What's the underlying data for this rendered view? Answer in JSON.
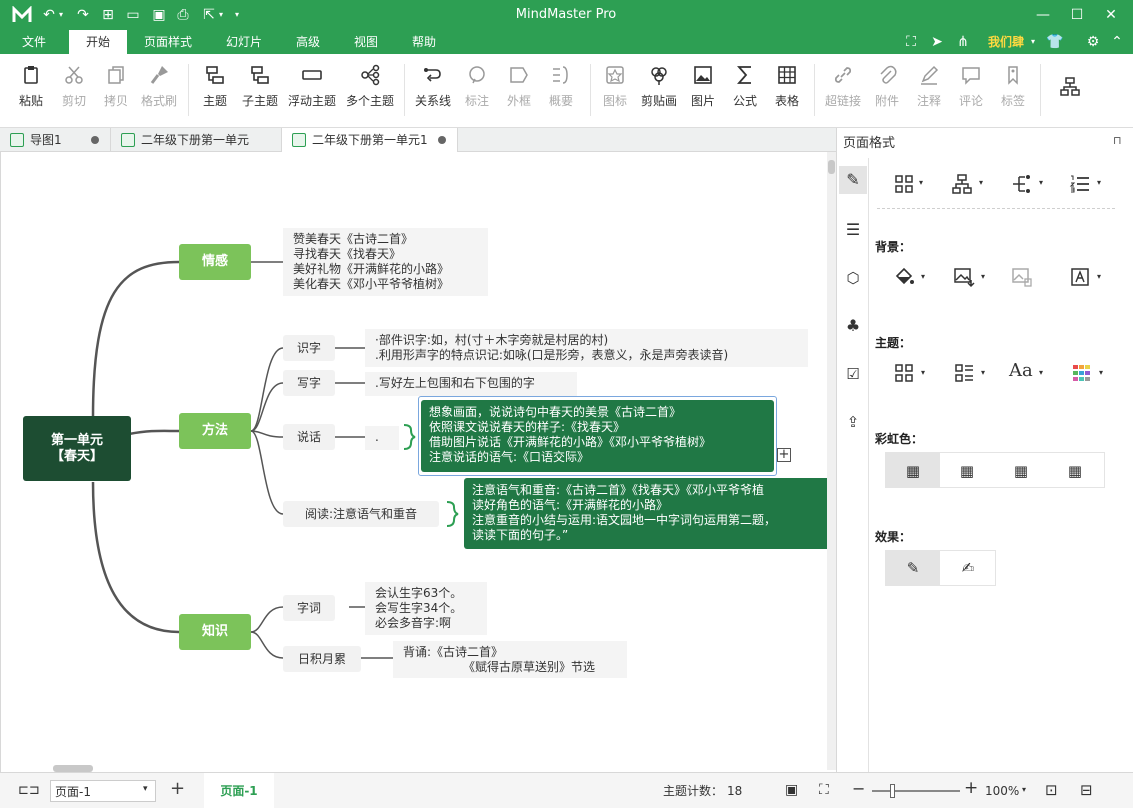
{
  "app": {
    "title": "MindMaster Pro",
    "user": "我们肆"
  },
  "menu": {
    "items": [
      "文件",
      "开始",
      "页面样式",
      "幻灯片",
      "高级",
      "视图",
      "帮助"
    ],
    "active": "开始"
  },
  "ribbon": {
    "buttons": [
      "粘贴",
      "剪切",
      "拷贝",
      "格式刷",
      "主题",
      "子主题",
      "浮动主题",
      "多个主题",
      "关系线",
      "标注",
      "外框",
      "概要",
      "图标",
      "剪贴画",
      "图片",
      "公式",
      "表格",
      "超链接",
      "附件",
      "注释",
      "评论",
      "标签"
    ]
  },
  "tabs": [
    {
      "label": "导图1"
    },
    {
      "label": "二年级下册第一单元"
    },
    {
      "label": "二年级下册第一单元1"
    }
  ],
  "mindmap": {
    "root": "第一单元\n【春天】",
    "branches": {
      "emotion": "情感",
      "method": "方法",
      "knowledge": "知识"
    },
    "emotion_notes": [
      "赞美春天《古诗二首》",
      "寻找春天《找春天》",
      "美好礼物《开满鲜花的小路》",
      "美化春天《邓小平爷爷植树》"
    ],
    "method_subs": {
      "shizi": "识字",
      "xiezi": "写字",
      "shuohua": "说话",
      "yuedu": "阅读:注意语气和重音"
    },
    "shizi_notes": [
      "·部件识字:如，村(寸＋木字旁就是村居的村)",
      ".利用形声字的特点识记:如咏(口是形旁，表意义，永是声旁表读音)"
    ],
    "xiezi_note": ".写好左上包围和右下包围的字",
    "shuohua_note": ".",
    "shuohua_box": [
      "想象画面，说说诗句中春天的美景《古诗二首》",
      "依照课文说说春天的样子:《找春天》",
      "借助图片说话《开满鲜花的小路》《邓小平爷爷植树》",
      "注意说话的语气:《口语交际》"
    ],
    "yuedu_box": [
      "注意语气和重音:《古诗二首》《找春天》《邓小平爷爷植",
      "读好角色的语气:《开满鲜花的小路》",
      "注意重音的小结与运用:语文园地一中字词句运用第二题，",
      "读读下面的句子。”"
    ],
    "knowledge_subs": {
      "ciyu": "字词",
      "jilei": "日积月累"
    },
    "ciyu_notes": [
      "会认生字63个。",
      "会写生字34个。",
      "必会多音字:啊"
    ],
    "jilei_notes": [
      "背诵:《古诗二首》",
      "《赋得古原草送别》节选"
    ]
  },
  "panel": {
    "title": "页面格式",
    "background": "背景：",
    "theme": "主题：",
    "rainbow": "彩虹色：",
    "effect": "效果："
  },
  "status": {
    "page_select": "页面-1",
    "page_tab": "页面-1",
    "topic_count_label": "主题计数：",
    "topic_count": "18",
    "zoom": "100%"
  },
  "colors": {
    "accent": "#2d9f53",
    "root": "#1d4d32",
    "branch": "#7cc35a",
    "box": "#207845"
  }
}
